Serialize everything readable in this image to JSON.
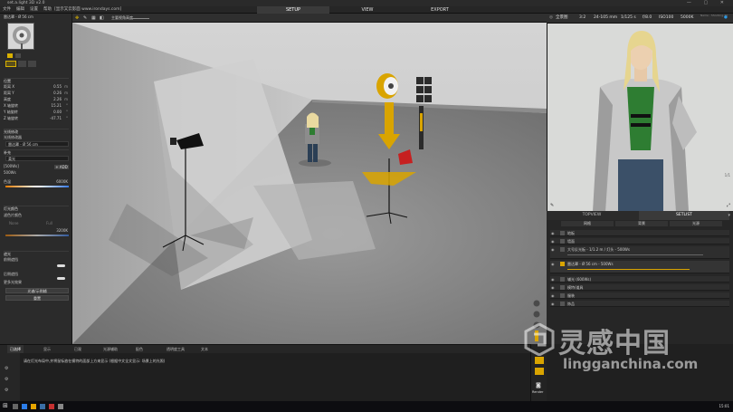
{
  "window": {
    "title": "set.a.light 3D v2.0",
    "controls": "— ▢ ✕"
  },
  "menu": {
    "items": [
      "文件",
      "编辑",
      "设置",
      "帮助"
    ],
    "link": "[显示又云影面  www.irondays.com]",
    "modes": [
      "SETUP",
      "VIEW",
      "EXPORT"
    ],
    "active_mode": "SETUP"
  },
  "viewport_toolbar": {
    "label": "主要视角高度"
  },
  "camera_bar": {
    "preset": "全景图",
    "ratio": "3:2",
    "lens": "24-105 mm",
    "shutter": "1/125 s",
    "aperture": "f/8.0",
    "iso": "ISO100",
    "wb": "5000K",
    "info": "Name - Shooting-2018-10C3.3D"
  },
  "left_panel": {
    "light_title": "雷达罩 - Ø 56 cm",
    "position_header": "位置",
    "position": [
      {
        "label": "距离 X",
        "value": "0.55",
        "unit": "m"
      },
      {
        "label": "距离 Y",
        "value": "0.26",
        "unit": "m"
      },
      {
        "label": "高度",
        "value": "2.26",
        "unit": "m"
      },
      {
        "label": "X 轴旋转",
        "value": "15.21",
        "unit": "°"
      },
      {
        "label": "Y 轴旋转",
        "value": "0.00",
        "unit": "°"
      },
      {
        "label": "Z 轴旋转",
        "value": "-47.71",
        "unit": "°"
      }
    ],
    "modifier_header": "光线修改",
    "modifier_sub": "光线修改器",
    "modifier_select": "雷达罩 - Ø 56 cm",
    "fill_header": "补充",
    "fill_select": "柔光",
    "power_label": "[500Ws]",
    "add_button": "+ ADD",
    "power_value": "500Ws",
    "color_label": "色温",
    "color_value": "6000K",
    "gel_header": "灯光颜色",
    "gel_label": "滤色片颜色",
    "gel_options": [
      "None",
      "Full"
    ],
    "kelvin_value": "3200K",
    "flags_header": "遮光",
    "flag1": "前侧遮挡",
    "flag2": "后侧遮挡",
    "more_label": "更多光效果",
    "btn1": "光谱/示例辅",
    "btn2": "重置"
  },
  "preview": {
    "counter": "1/1"
  },
  "topview": {
    "tabs": [
      "TOPVIEW",
      "SETLIST"
    ],
    "active": "SETLIST"
  },
  "setlist": {
    "tabs": [
      "网格",
      "背景",
      "光源"
    ],
    "items": [
      {
        "label": "地板"
      },
      {
        "label": "墙面"
      },
      {
        "label": "大号反光板 - 1/1.2 m  / 灯头 - 500Ws"
      },
      {
        "label": "雷达罩 - Ø 56 cm - 500Ws"
      },
      {
        "label": "辅光 (600Ws)"
      },
      {
        "label": "模特/道具"
      },
      {
        "label": "服装"
      },
      {
        "label": "饰品"
      }
    ]
  },
  "bottom": {
    "tabs": [
      "已选择",
      "显示",
      "已观",
      "光源辅助",
      "配色",
      "透明度工具",
      "文本"
    ],
    "active_tab": "已选择",
    "message": "请在灯光布局中,并将鼠标放在模特的面部上方来显示 (根据中文全文显示: 场景上的光照)"
  },
  "render": {
    "label": "Render"
  },
  "watermark": {
    "text": "灵感中国",
    "url": "lingganchina.com"
  },
  "taskbar": {
    "time": "15:01"
  }
}
